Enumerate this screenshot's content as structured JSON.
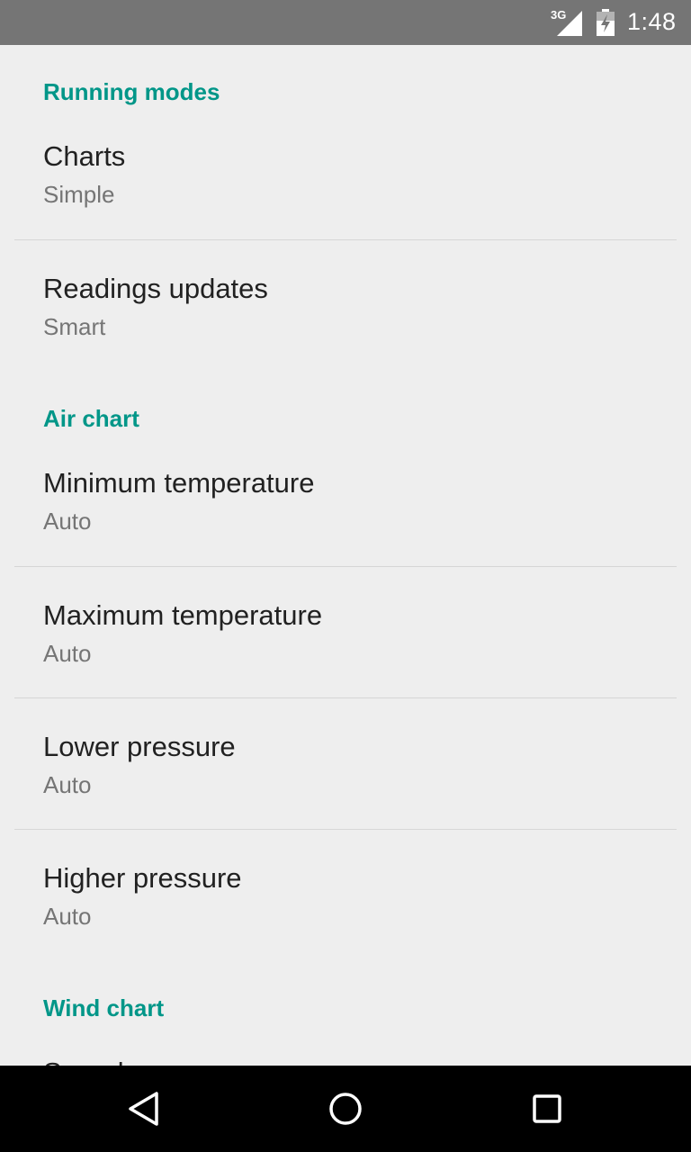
{
  "status_bar": {
    "network_type": "3G",
    "time": "1:48"
  },
  "sections": [
    {
      "header": "Running modes",
      "items": [
        {
          "title": "Charts",
          "summary": "Simple"
        },
        {
          "title": "Readings updates",
          "summary": "Smart"
        }
      ]
    },
    {
      "header": "Air chart",
      "items": [
        {
          "title": "Minimum temperature",
          "summary": "Auto"
        },
        {
          "title": "Maximum temperature",
          "summary": "Auto"
        },
        {
          "title": "Lower pressure",
          "summary": "Auto"
        },
        {
          "title": "Higher pressure",
          "summary": "Auto"
        }
      ]
    },
    {
      "header": "Wind chart",
      "items": [
        {
          "title": "Speed",
          "summary": ""
        }
      ]
    }
  ],
  "nav_bar": {
    "back_icon": "back-triangle-icon",
    "home_icon": "home-circle-icon",
    "recents_icon": "recents-square-icon"
  },
  "colors": {
    "accent": "#009688",
    "status_bar": "#757575",
    "background": "#eeeeee",
    "title_text": "#212121",
    "summary_text": "#757575",
    "nav_bar": "#000000"
  }
}
